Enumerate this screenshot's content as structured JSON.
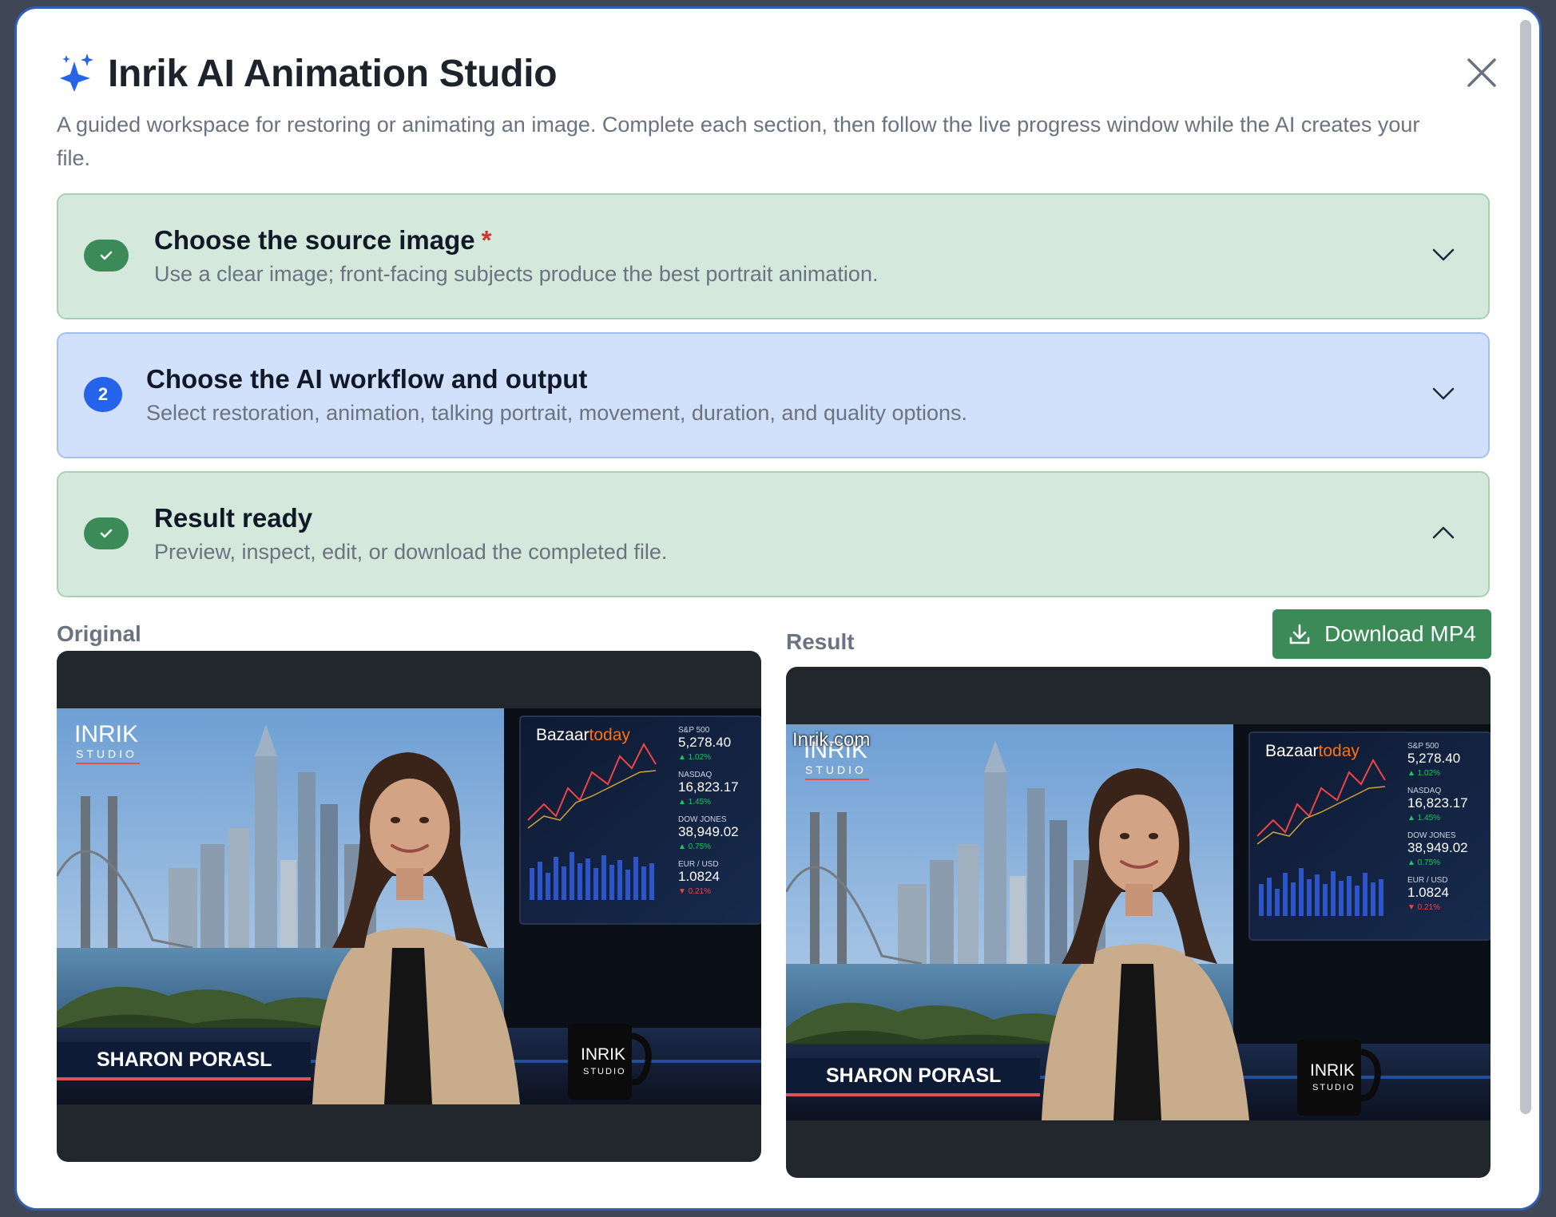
{
  "dialog": {
    "title": "Inrik AI Animation Studio",
    "subtitle": "A guided workspace for restoring or animating an image. Complete each section, then follow the live progress window while the AI creates your file.",
    "header_icon": "sparkles-icon",
    "close_icon": "close-icon"
  },
  "sections": [
    {
      "title": "Choose the source image",
      "required_mark": "*",
      "description": "Use a clear image; front-facing subjects produce the best portrait animation.",
      "status": "complete",
      "expanded": false
    },
    {
      "step": "2",
      "title": "Choose the AI workflow and output",
      "description": "Select restoration, animation, talking portrait, movement, duration, and quality options.",
      "status": "current",
      "expanded": false
    },
    {
      "title": "Result ready",
      "description": "Preview, inspect, edit, or download the completed file.",
      "status": "complete",
      "expanded": true
    }
  ],
  "result": {
    "original_label": "Original",
    "result_label": "Result",
    "download_label": "Download MP4",
    "watermark": "Inrik.com"
  },
  "scene": {
    "logo_main": "INRIK",
    "logo_sub": "STUDIO",
    "lower_third_name": "SHARON  PORASL",
    "mug_main": "INRIK",
    "mug_sub": "STUDIO",
    "screen_brand_a": "Bazaar",
    "screen_brand_b": "today",
    "tickers": [
      {
        "name": "S&P 500",
        "value": "5,278.40",
        "change": "▲ 1.02%",
        "dir": "up"
      },
      {
        "name": "NASDAQ",
        "value": "16,823.17",
        "change": "▲ 1.45%",
        "dir": "up"
      },
      {
        "name": "DOW JONES",
        "value": "38,949.02",
        "change": "▲ 0.75%",
        "dir": "up"
      },
      {
        "name": "EUR / USD",
        "value": "1.0824",
        "change": "▼ 0.21%",
        "dir": "down"
      }
    ]
  },
  "colors": {
    "complete_bg": "#d5e8dc",
    "current_bg": "#d2e1fb",
    "accent_green": "#3b8a57",
    "accent_blue": "#2563eb"
  }
}
